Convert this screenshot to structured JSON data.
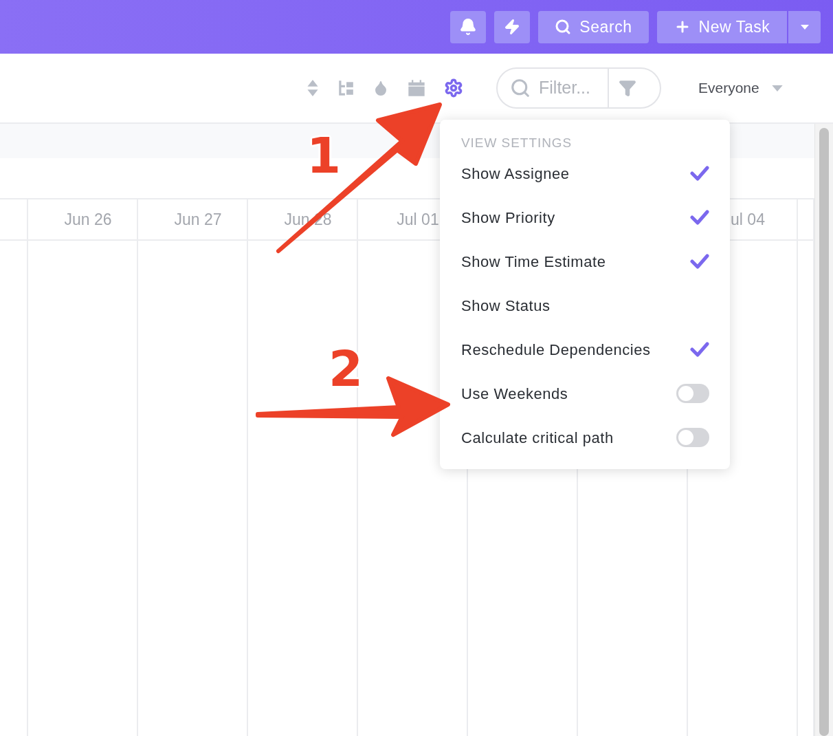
{
  "top_bar": {
    "buttons": [
      {
        "kind": "bell"
      },
      {
        "kind": "bolt"
      },
      {
        "kind": "search",
        "label": "Search"
      }
    ],
    "new_task": {
      "label": "New Task"
    }
  },
  "toolbar": {
    "icons": [
      {
        "kind": "sort",
        "active": false
      },
      {
        "kind": "tree",
        "active": false
      },
      {
        "kind": "drop",
        "active": false
      },
      {
        "kind": "calendar",
        "active": false
      },
      {
        "kind": "gear",
        "active": true
      }
    ],
    "filter": {
      "placeholder": "Filter..."
    },
    "assignee": {
      "label": "Everyone"
    }
  },
  "timeline": {
    "columns": [
      {},
      {
        "label": "Jun 26"
      },
      {
        "label": "Jun 27"
      },
      {
        "label": "Jun 28"
      },
      {
        "label": "Jul 01"
      },
      {},
      {},
      {
        "label": "ul 04"
      },
      {}
    ]
  },
  "view_settings": {
    "title": "VIEW SETTINGS",
    "items": [
      {
        "label": "Show Assignee",
        "kind": "check",
        "on": true
      },
      {
        "label": "Show Priority",
        "kind": "check",
        "on": true
      },
      {
        "label": "Show Time Estimate",
        "kind": "check",
        "on": true
      },
      {
        "label": "Show Status",
        "kind": "check",
        "on": false
      },
      {
        "label": "Reschedule Dependencies",
        "kind": "check",
        "on": true
      },
      {
        "label": "Use Weekends",
        "kind": "toggle",
        "on": false
      },
      {
        "label": "Calculate critical path",
        "kind": "toggle",
        "on": false
      }
    ]
  },
  "annotations": [
    {
      "label": "1"
    },
    {
      "label": "2"
    }
  ]
}
